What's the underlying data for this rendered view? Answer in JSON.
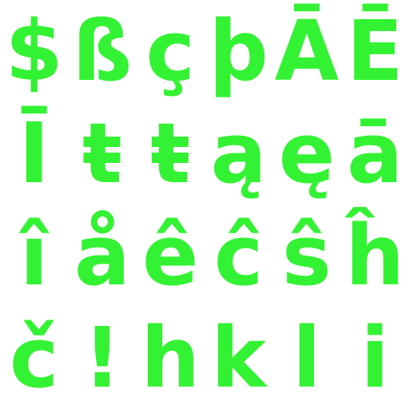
{
  "glyph_color": "#33f233",
  "background_color": "#ffffff",
  "rows": [
    [
      "$",
      "ß",
      "ç",
      "þ",
      "Ā",
      "Ē"
    ],
    [
      "Ī",
      "ŧ",
      "ŧ",
      "ą",
      "ę",
      "ā"
    ],
    [
      "î",
      "å",
      "ê",
      "ĉ",
      "ŝ",
      "ĥ"
    ],
    [
      "č",
      "!",
      "h",
      "k",
      "l",
      "i"
    ]
  ]
}
